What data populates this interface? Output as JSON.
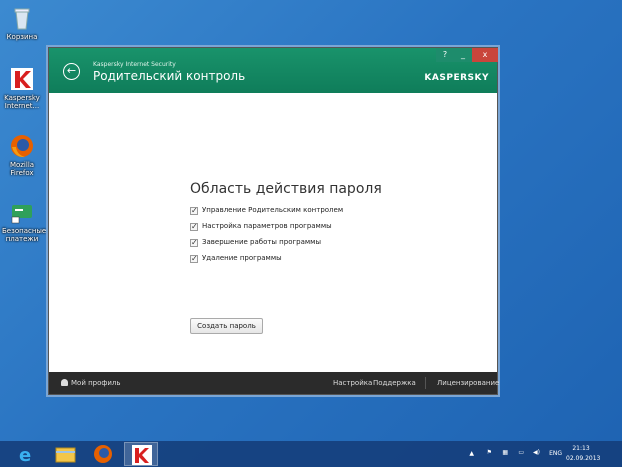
{
  "desktop": {
    "icons": [
      {
        "label": "Корзина"
      },
      {
        "label": "Kaspersky Internet..."
      },
      {
        "label": "Mozilla Firefox"
      },
      {
        "label": "Безопасные платежи"
      }
    ]
  },
  "window": {
    "app_name": "Kaspersky Internet Security",
    "title": "Родительский контроль",
    "brand": "KASPERSKY",
    "help_label": "?",
    "min_label": "_",
    "close_label": "x",
    "back_label": "←",
    "section_title": "Область действия пароля",
    "options": [
      {
        "label": "Управление Родительским контролем",
        "checked": true
      },
      {
        "label": "Настройка параметров программы",
        "checked": true
      },
      {
        "label": "Завершение работы программы",
        "checked": true
      },
      {
        "label": "Удаление программы",
        "checked": true
      }
    ],
    "create_button": "Создать пароль",
    "footer": {
      "profile": "Мой профиль",
      "settings": "Настройка",
      "support": "Поддержка",
      "licensing": "Лицензирование"
    }
  },
  "taskbar": {
    "apps": [
      {
        "icon": "ie-icon"
      },
      {
        "icon": "explorer-icon"
      },
      {
        "icon": "firefox-icon"
      },
      {
        "icon": "kaspersky-icon",
        "active": true
      }
    ],
    "tray": {
      "lang": "ENG",
      "time": "21:13",
      "date": "02.09.2013"
    }
  },
  "colors": {
    "titlebar": "#13875f",
    "close": "#c9453b",
    "footer": "#2b2b2b",
    "desktop": "#2a74c2"
  }
}
